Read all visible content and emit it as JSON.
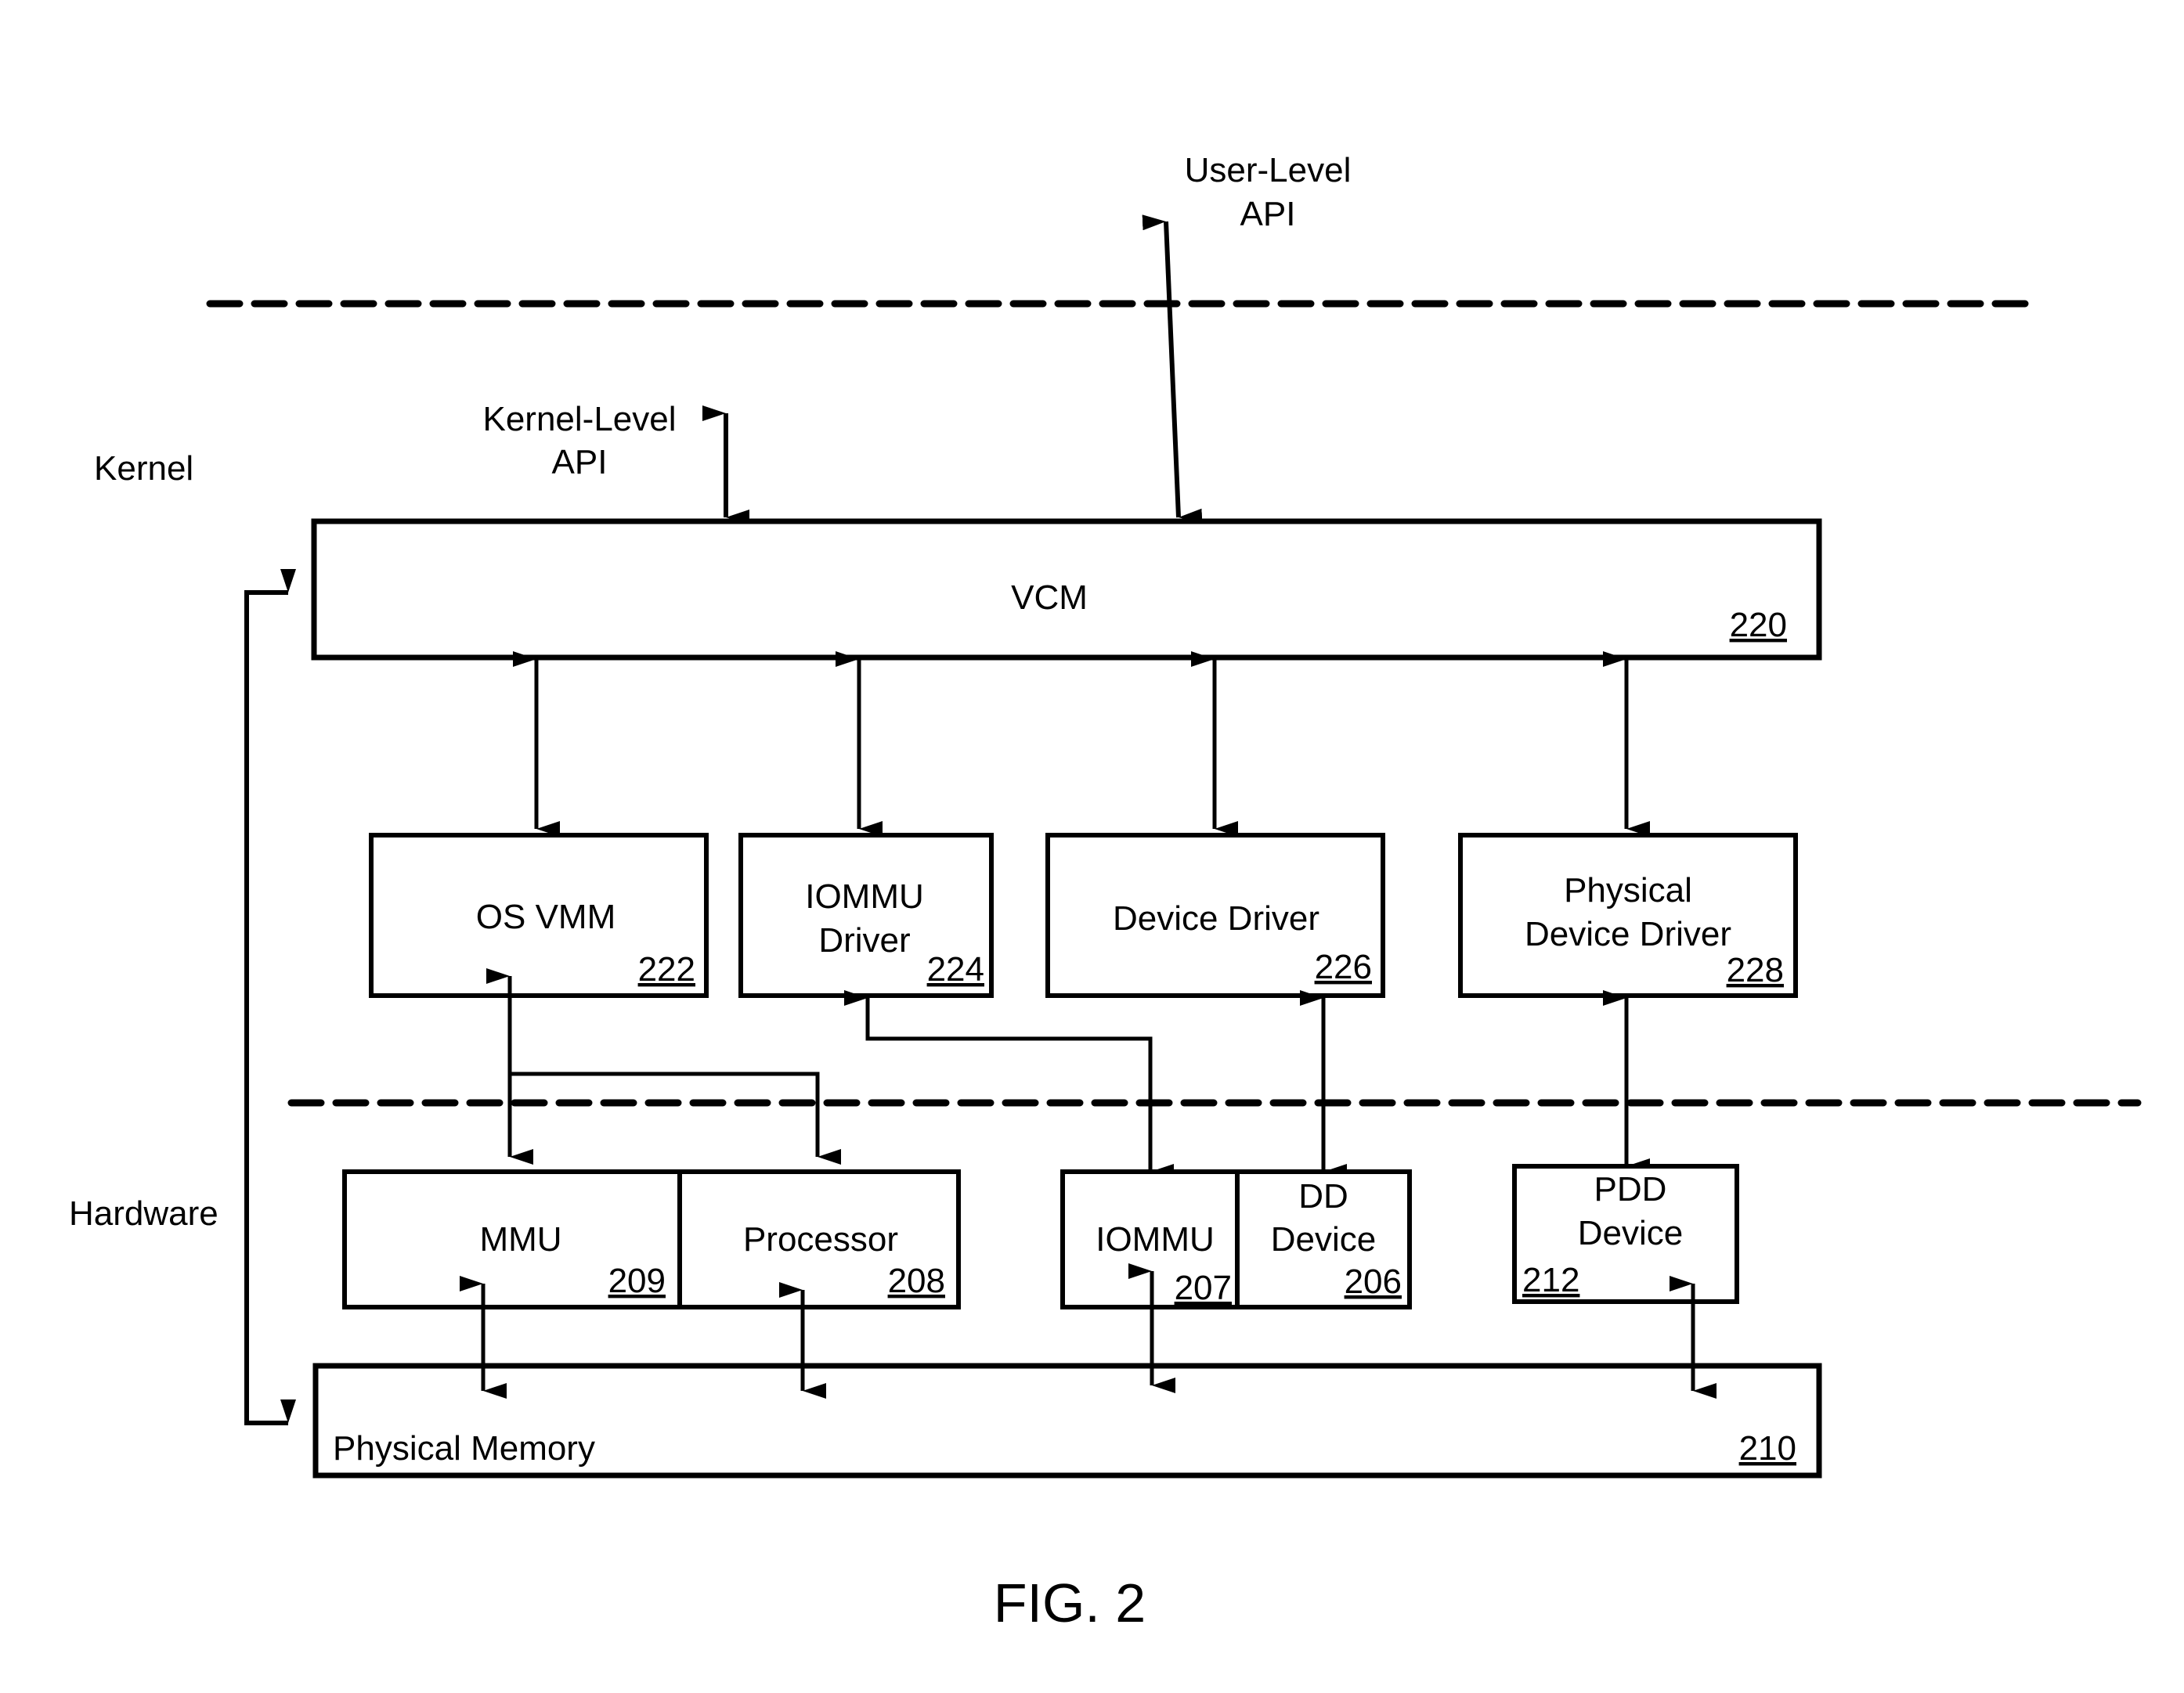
{
  "figure": {
    "caption": "FIG. 2",
    "colors": {
      "line": "#000000",
      "background": "#ffffff"
    }
  },
  "regions": {
    "kernel_label": "Kernel",
    "hardware_label": "Hardware"
  },
  "apis": {
    "user_level": [
      "User-Level",
      "API"
    ],
    "kernel_level": [
      "Kernel-Level",
      "API"
    ]
  },
  "blocks": {
    "vcm": {
      "label": [
        "VCM"
      ],
      "ref": "220"
    },
    "os_vmm": {
      "label": [
        "OS VMM"
      ],
      "ref": "222"
    },
    "iommu_driver": {
      "label": [
        "IOMMU",
        "Driver"
      ],
      "ref": "224"
    },
    "device_driver": {
      "label": [
        "Device Driver"
      ],
      "ref": "226"
    },
    "physical_device_driver": {
      "label": [
        "Physical",
        "Device Driver"
      ],
      "ref": "228"
    },
    "mmu": {
      "label": [
        "MMU"
      ],
      "ref": "209"
    },
    "processor": {
      "label": [
        "Processor"
      ],
      "ref": "208"
    },
    "iommu": {
      "label": [
        "IOMMU"
      ],
      "ref": "207"
    },
    "dd_device": {
      "label": [
        "DD",
        "Device"
      ],
      "ref": "206"
    },
    "pdd_device": {
      "label": [
        "PDD",
        "Device"
      ],
      "ref": "212"
    },
    "physical_memory": {
      "label": [
        "Physical Memory"
      ],
      "ref": "210"
    }
  },
  "connections": [
    {
      "from": "user_level_api",
      "to": "vcm",
      "type": "bidirectional"
    },
    {
      "from": "kernel_level_api",
      "to": "vcm",
      "type": "bidirectional"
    },
    {
      "from": "vcm",
      "to": "os_vmm",
      "type": "bidirectional"
    },
    {
      "from": "vcm",
      "to": "iommu_driver",
      "type": "bidirectional"
    },
    {
      "from": "vcm",
      "to": "device_driver",
      "type": "bidirectional"
    },
    {
      "from": "vcm",
      "to": "physical_device_driver",
      "type": "bidirectional"
    },
    {
      "from": "os_vmm",
      "to": "mmu",
      "type": "bidirectional"
    },
    {
      "from": "os_vmm",
      "to": "processor",
      "type": "directed"
    },
    {
      "from": "iommu_driver",
      "to": "iommu",
      "type": "bidirectional"
    },
    {
      "from": "device_driver",
      "to": "dd_device",
      "type": "bidirectional"
    },
    {
      "from": "physical_device_driver",
      "to": "pdd_device",
      "type": "bidirectional"
    },
    {
      "from": "mmu",
      "to": "physical_memory",
      "type": "bidirectional"
    },
    {
      "from": "processor",
      "to": "physical_memory",
      "type": "bidirectional"
    },
    {
      "from": "iommu",
      "to": "physical_memory",
      "type": "bidirectional"
    },
    {
      "from": "pdd_device",
      "to": "physical_memory",
      "type": "bidirectional"
    },
    {
      "from": "feedback_loop",
      "to": "vcm",
      "type": "directed"
    },
    {
      "from": "feedback_loop",
      "to": "physical_memory",
      "type": "directed"
    }
  ]
}
